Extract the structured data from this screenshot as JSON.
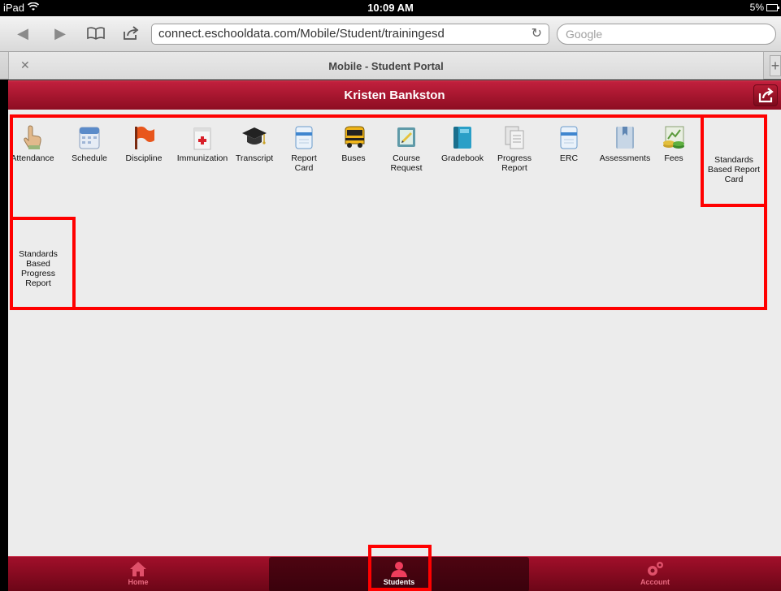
{
  "status": {
    "device": "iPad",
    "time": "10:09 AM",
    "battery": "5%"
  },
  "browser": {
    "url": "connect.eschooldata.com/Mobile/Student/trainingesd",
    "search_placeholder": "Google",
    "tab_title": "Mobile - Student Portal"
  },
  "header": {
    "student_name": "Kristen Bankston"
  },
  "tiles": [
    {
      "label": "Attendance",
      "icon": "hand-pointer-icon"
    },
    {
      "label": "Schedule",
      "icon": "calendar-icon"
    },
    {
      "label": "Discipline",
      "icon": "flag-icon"
    },
    {
      "label": "Immunization",
      "icon": "medical-kit-icon"
    },
    {
      "label": "Transcript",
      "icon": "graduation-cap-icon"
    },
    {
      "label": "Report Card",
      "icon": "document-icon"
    },
    {
      "label": "Buses",
      "icon": "bus-icon"
    },
    {
      "label": "Course Request",
      "icon": "request-icon"
    },
    {
      "label": "Gradebook",
      "icon": "book-icon"
    },
    {
      "label": "Progress Report",
      "icon": "report-icon"
    },
    {
      "label": "ERC",
      "icon": "document-icon"
    },
    {
      "label": "Assessments",
      "icon": "bookmark-icon"
    },
    {
      "label": "Fees",
      "icon": "money-icon"
    },
    {
      "label": "Standards Based Report Card",
      "icon": ""
    },
    {
      "label": "Standards Based Progress Report",
      "icon": ""
    }
  ],
  "bottom_nav": [
    {
      "label": "Home",
      "icon": "home-icon"
    },
    {
      "label": "Students",
      "icon": "person-icon",
      "active": true
    },
    {
      "label": "Account",
      "icon": "gears-icon"
    }
  ],
  "colors": {
    "brand": "#a51630",
    "highlight": "#ff0000",
    "background": "#ececec"
  }
}
